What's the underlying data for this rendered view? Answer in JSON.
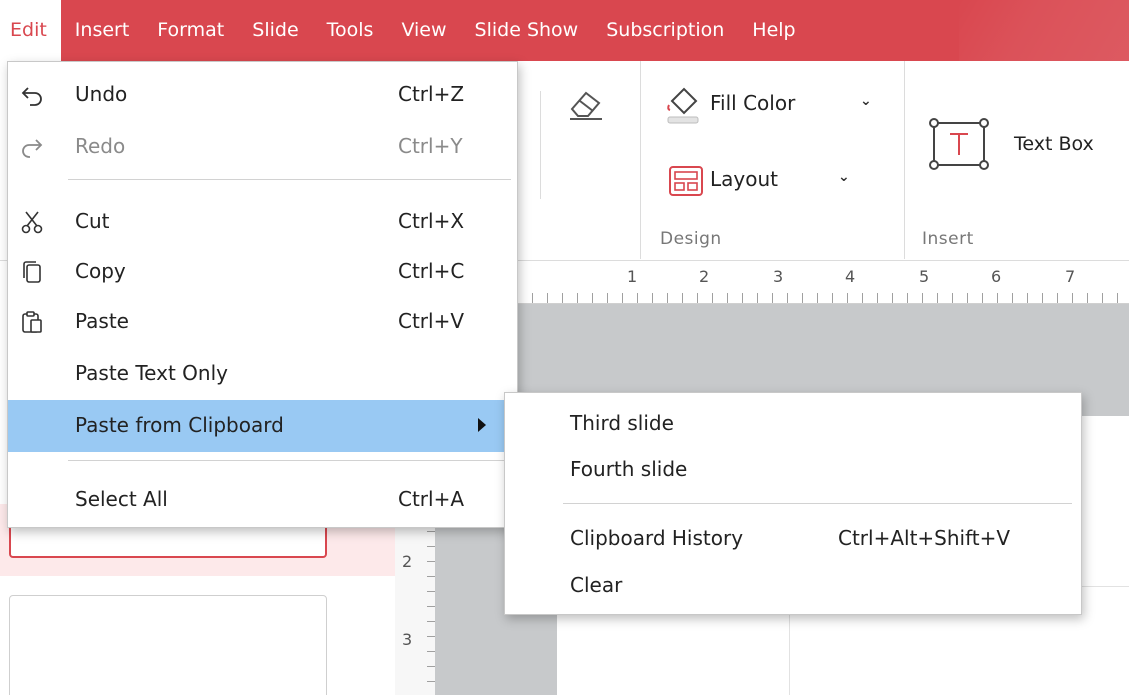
{
  "menubar": {
    "items": [
      "Edit",
      "Insert",
      "Format",
      "Slide",
      "Tools",
      "View",
      "Slide Show",
      "Subscription",
      "Help"
    ]
  },
  "ribbon": {
    "fill_color_label": "Fill Color",
    "layout_label": "Layout",
    "text_box_label": "Text Box",
    "group_design": "Design",
    "group_insert": "Insert"
  },
  "ruler": {
    "h_numbers": [
      "1",
      "2",
      "3",
      "4",
      "5",
      "6",
      "7"
    ],
    "v_numbers": [
      "2",
      "3"
    ]
  },
  "edit_menu": {
    "items": [
      {
        "label": "Undo",
        "shortcut": "Ctrl+Z",
        "icon": "undo-icon"
      },
      {
        "label": "Redo",
        "shortcut": "Ctrl+Y",
        "icon": "redo-icon"
      },
      {
        "label": "Cut",
        "shortcut": "Ctrl+X",
        "icon": "scissors-icon"
      },
      {
        "label": "Copy",
        "shortcut": "Ctrl+C",
        "icon": "copy-icon"
      },
      {
        "label": "Paste",
        "shortcut": "Ctrl+V",
        "icon": "paste-icon"
      },
      {
        "label": "Paste Text Only",
        "shortcut": ""
      },
      {
        "label": "Paste from Clipboard",
        "shortcut": ""
      },
      {
        "label": "Select All",
        "shortcut": "Ctrl+A"
      }
    ]
  },
  "clipboard_submenu": {
    "items": [
      {
        "label": "Third slide"
      },
      {
        "label": "Fourth slide"
      },
      {
        "label": "Clipboard History",
        "shortcut": "Ctrl+Alt+Shift+V"
      },
      {
        "label": "Clear"
      }
    ]
  },
  "colors": {
    "accent": "#d9474f",
    "menu_highlight": "#99c9f3",
    "canvas_gray": "#c7c9cb"
  }
}
